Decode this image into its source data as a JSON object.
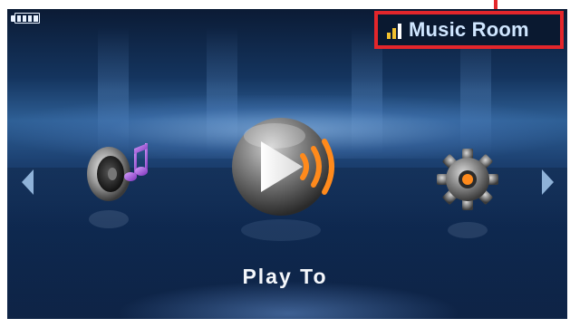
{
  "status_bar": {
    "battery_icon": "battery-full-icon",
    "signal_icon": "signal-strength-icon",
    "room_name": "Music Room"
  },
  "carousel": {
    "prev_icon": "arrow-left-icon",
    "next_icon": "arrow-right-icon",
    "items": [
      {
        "icon": "speaker-music-icon"
      },
      {
        "icon": "play-to-icon"
      },
      {
        "icon": "settings-gear-icon"
      }
    ],
    "selected_label": "Play To"
  },
  "colors": {
    "highlight_border": "#e3262b",
    "title_text": "#cfe6ff",
    "accent_orange": "#ff8a1c",
    "signal_yellow": "#f2c12e"
  }
}
